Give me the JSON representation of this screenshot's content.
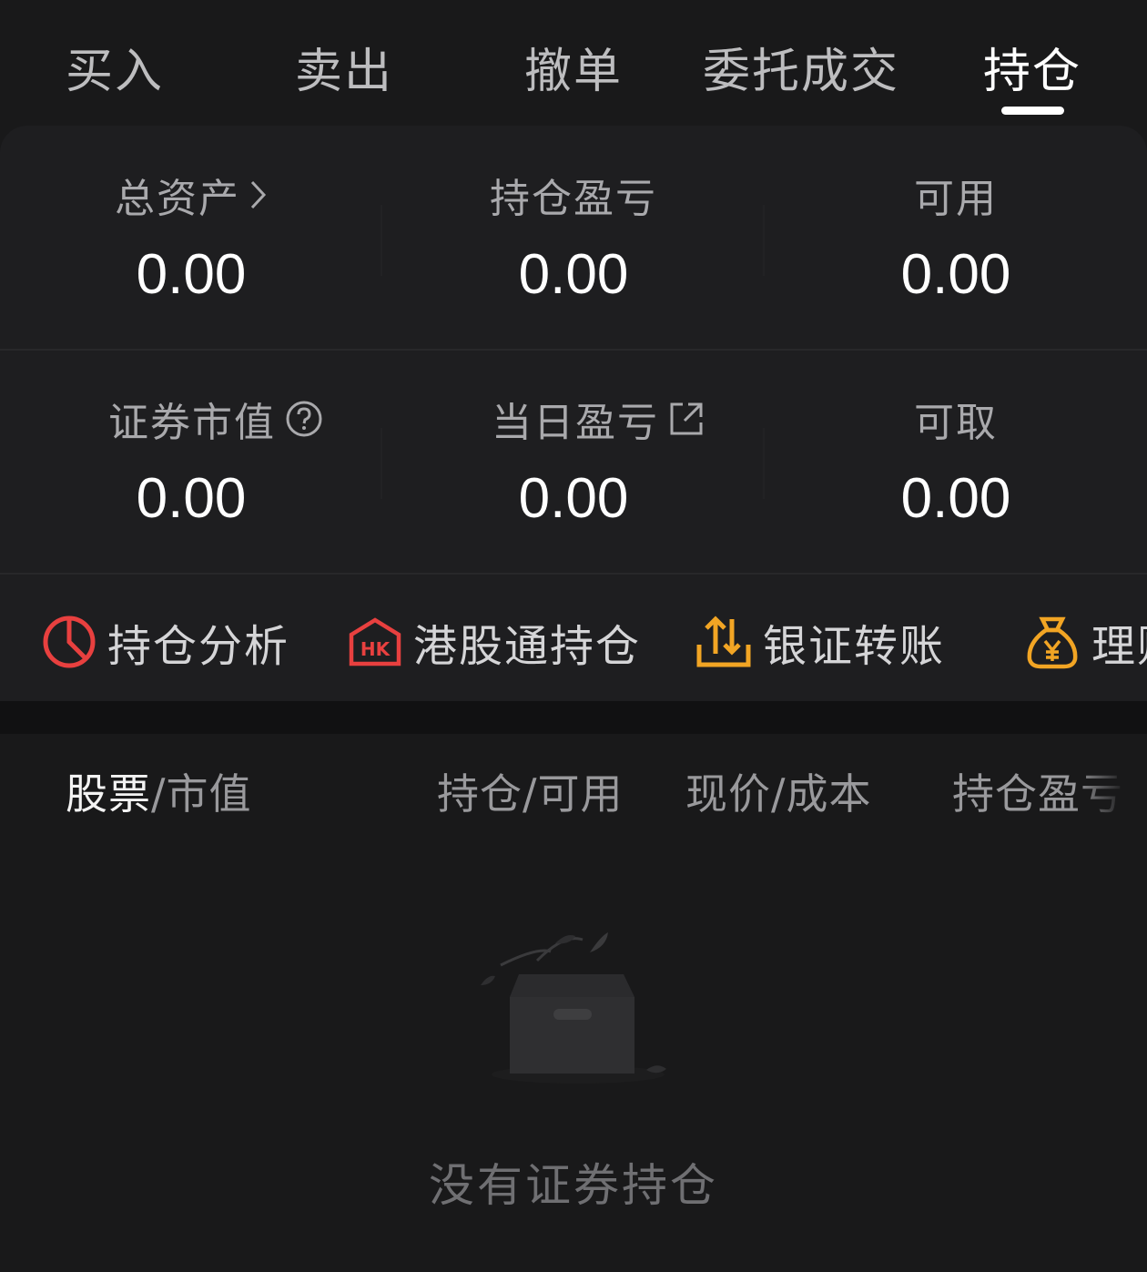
{
  "tabs": [
    {
      "label": "买入"
    },
    {
      "label": "卖出"
    },
    {
      "label": "撤单"
    },
    {
      "label": "委托成交"
    },
    {
      "label": "持仓",
      "active": true
    }
  ],
  "summary": {
    "total_assets": {
      "label": "总资产",
      "value": "0.00"
    },
    "position_pnl": {
      "label": "持仓盈亏",
      "value": "0.00"
    },
    "available": {
      "label": "可用",
      "value": "0.00"
    },
    "market_value": {
      "label": "证券市值",
      "value": "0.00"
    },
    "daily_pnl": {
      "label": "当日盈亏",
      "value": "0.00"
    },
    "withdrawable": {
      "label": "可取",
      "value": "0.00"
    }
  },
  "actions": [
    {
      "label": "持仓分析",
      "icon": "pie-chart-icon",
      "color": "#e8403f"
    },
    {
      "label": "港股通持仓",
      "icon": "hk-icon",
      "color": "#e8403f"
    },
    {
      "label": "银证转账",
      "icon": "transfer-icon",
      "color": "#f2a524"
    },
    {
      "label": "理财",
      "icon": "money-bag-icon",
      "color": "#f2a524"
    }
  ],
  "table_header": {
    "stock": "股票",
    "market_value_suffix": "/市值",
    "position_available": "持仓/可用",
    "price_cost": "现价/成本",
    "position_pnl": "持仓盈亏"
  },
  "empty_state": {
    "text": "没有证券持仓",
    "icon": "empty-box-icon"
  },
  "colors": {
    "background": "#19191a",
    "card": "#1e1e20",
    "accent_red": "#e8403f",
    "accent_orange": "#f2a524"
  }
}
